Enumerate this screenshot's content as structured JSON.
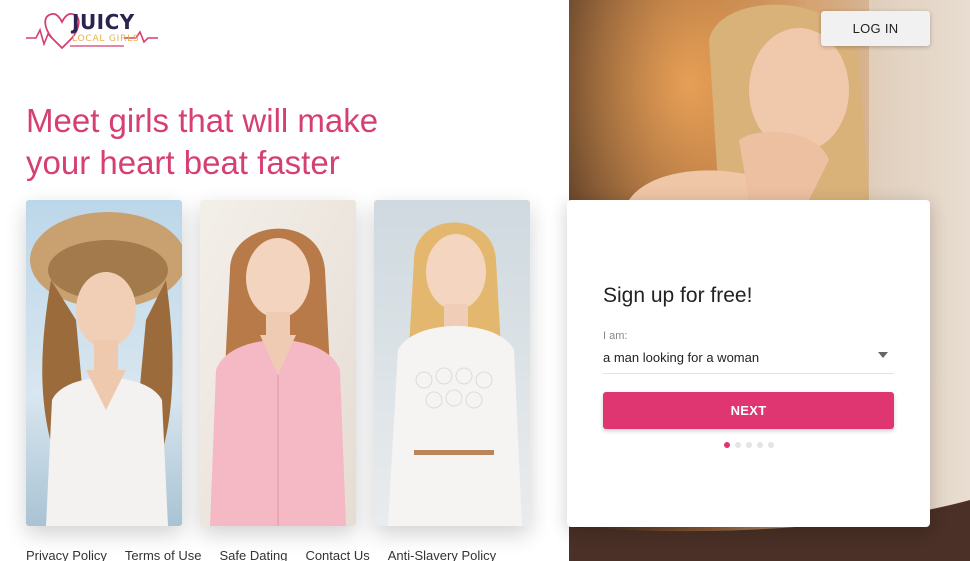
{
  "logo": {
    "word": "JUICY",
    "sub": "LOCAL GIRLS"
  },
  "header": {
    "login_label": "LOG IN"
  },
  "hero": {
    "headline_line1": "Meet girls that will make",
    "headline_line2": "your heart beat faster"
  },
  "cards": [
    {
      "alt": "woman-in-straw-hat"
    },
    {
      "alt": "woman-in-pink-shirt"
    },
    {
      "alt": "woman-in-white-lace-dress"
    }
  ],
  "signup": {
    "title": "Sign up for free!",
    "iam_label": "I am:",
    "selected_option": "a man looking for a woman",
    "next_label": "NEXT",
    "steps_total": 5,
    "step_current": 1
  },
  "footer": {
    "links": [
      "Privacy Policy",
      "Terms of Use",
      "Safe Dating",
      "Contact Us",
      "Anti-Slavery Policy"
    ]
  },
  "colors": {
    "accent": "#df3570",
    "headline": "#d63f72",
    "logo_text": "#2a2550",
    "logo_sub": "#e7b24a"
  }
}
